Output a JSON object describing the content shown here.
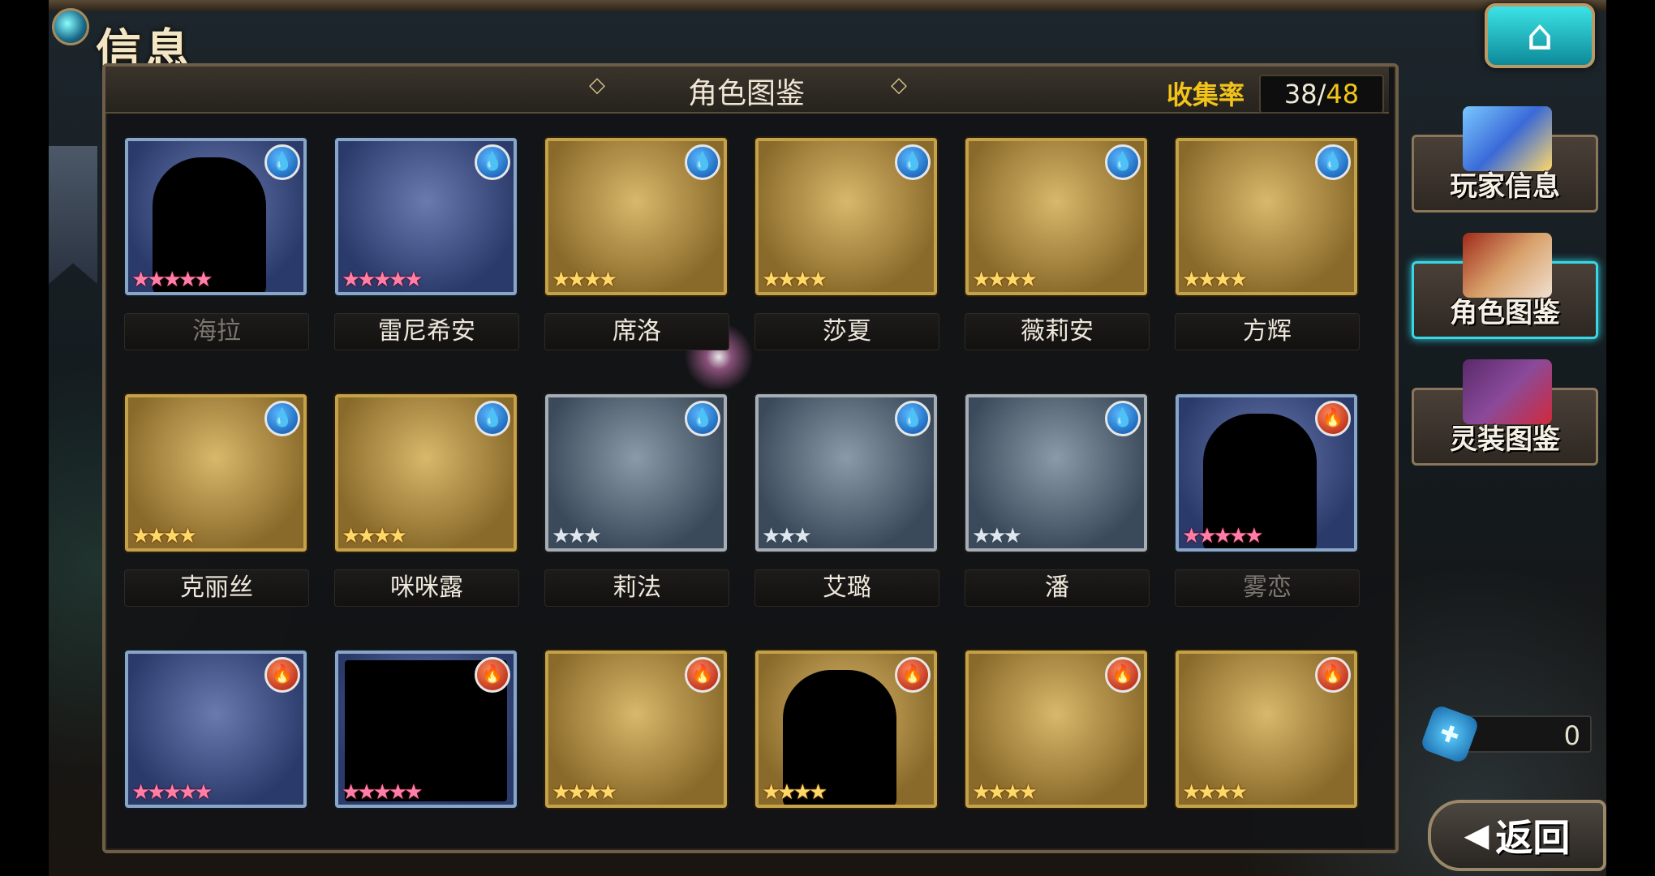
{
  "header": {
    "title": "信息",
    "panel_title": "角色图鉴",
    "collect_label": "收集率",
    "collect_current": "38",
    "collect_sep": "/",
    "collect_total": "48"
  },
  "cards": [
    {
      "name": "海拉",
      "element": "water",
      "stars": "★★★★★",
      "rarity": "pink",
      "locked": true
    },
    {
      "name": "雷尼希安",
      "element": "water",
      "stars": "★★★★★",
      "rarity": "pink",
      "locked": false
    },
    {
      "name": "席洛",
      "element": "water",
      "stars": "★★★★",
      "rarity": "gold",
      "locked": false
    },
    {
      "name": "莎夏",
      "element": "water",
      "stars": "★★★★",
      "rarity": "gold",
      "locked": false
    },
    {
      "name": "薇莉安",
      "element": "water",
      "stars": "★★★★",
      "rarity": "gold",
      "locked": false
    },
    {
      "name": "方辉",
      "element": "water",
      "stars": "★★★★",
      "rarity": "gold",
      "locked": false
    },
    {
      "name": "克丽丝",
      "element": "water",
      "stars": "★★★★",
      "rarity": "gold",
      "locked": false
    },
    {
      "name": "咪咪露",
      "element": "water",
      "stars": "★★★★",
      "rarity": "gold",
      "locked": false
    },
    {
      "name": "莉法",
      "element": "water",
      "stars": "★★★",
      "rarity": "silver",
      "locked": false
    },
    {
      "name": "艾璐",
      "element": "water",
      "stars": "★★★",
      "rarity": "silver",
      "locked": false
    },
    {
      "name": "潘",
      "element": "water",
      "stars": "★★★",
      "rarity": "silver",
      "locked": false
    },
    {
      "name": "雾恋",
      "element": "fire",
      "stars": "★★★★★",
      "rarity": "pink",
      "locked": true
    },
    {
      "name": "",
      "element": "fire",
      "stars": "★★★★★",
      "rarity": "pink",
      "locked": false
    },
    {
      "name": "",
      "element": "fire",
      "stars": "★★★★★",
      "rarity": "pink",
      "locked": true
    },
    {
      "name": "",
      "element": "fire",
      "stars": "★★★★",
      "rarity": "gold",
      "locked": false
    },
    {
      "name": "",
      "element": "fire",
      "stars": "★★★★",
      "rarity": "gold",
      "locked": true
    },
    {
      "name": "",
      "element": "fire",
      "stars": "★★★★",
      "rarity": "gold",
      "locked": false
    },
    {
      "name": "",
      "element": "fire",
      "stars": "★★★★",
      "rarity": "gold",
      "locked": false
    }
  ],
  "side_menu": {
    "player_info": "玩家信息",
    "character_codex": "角色图鉴",
    "equipment_codex": "灵装图鉴"
  },
  "counter": {
    "value": "0"
  },
  "back_button": {
    "label": "返回"
  },
  "icons": {
    "home": "home-icon",
    "back": "back-arrow-icon",
    "water": "water-drop-icon",
    "fire": "fire-icon",
    "puzzle": "puzzle-piece-icon"
  },
  "colors": {
    "accent_gold": "#f2c419",
    "active_cyan": "#39d7e6",
    "water_blue": "#0a4fa6",
    "fire_red": "#a8170a"
  }
}
